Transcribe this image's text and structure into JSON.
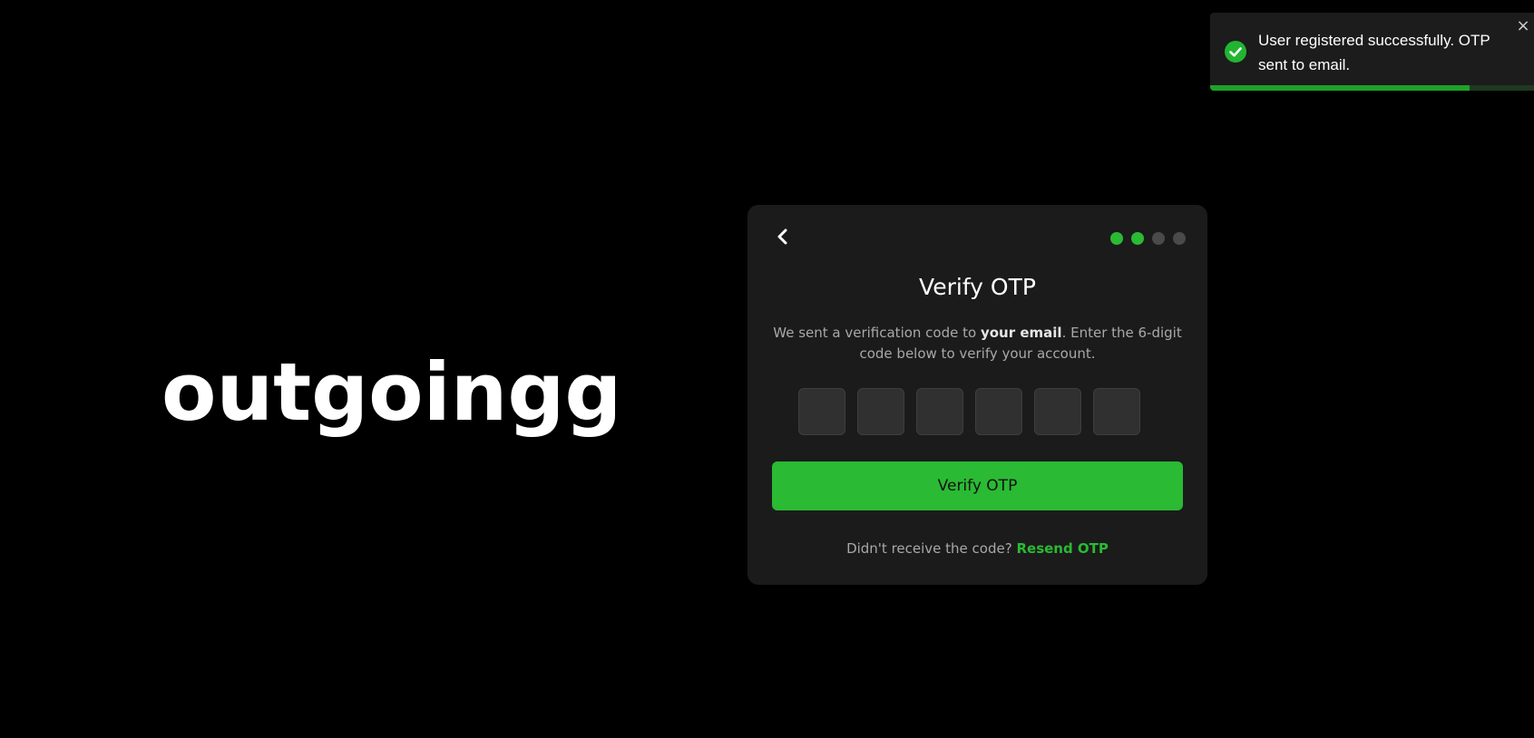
{
  "brand": {
    "name": "outgoingg"
  },
  "toast": {
    "message": "User registered successfully. OTP sent to email.",
    "close_symbol": "×",
    "progress": 0.8,
    "icon": "check-circle-icon",
    "colors": {
      "icon": "#21b531",
      "progress": "#1fa329"
    }
  },
  "otp_card": {
    "back_icon": "chevron-left-icon",
    "steps": [
      {
        "active": true
      },
      {
        "active": true
      },
      {
        "active": false
      },
      {
        "active": false
      }
    ],
    "step_colors": {
      "active": "#2aba33",
      "inactive": "#4a4a4a"
    },
    "title": "Verify OTP",
    "description": {
      "part1": "We sent a verification code to ",
      "emphasis": "your email",
      "part2": ". Enter the 6-digit code below to verify your account."
    },
    "otp_digits": [
      "",
      "",
      "",
      "",
      "",
      ""
    ],
    "verify_button_label": "Verify OTP",
    "resend_prompt": "Didn't receive the code?",
    "resend_link": "Resend OTP",
    "accent_color": "#2aba33"
  }
}
